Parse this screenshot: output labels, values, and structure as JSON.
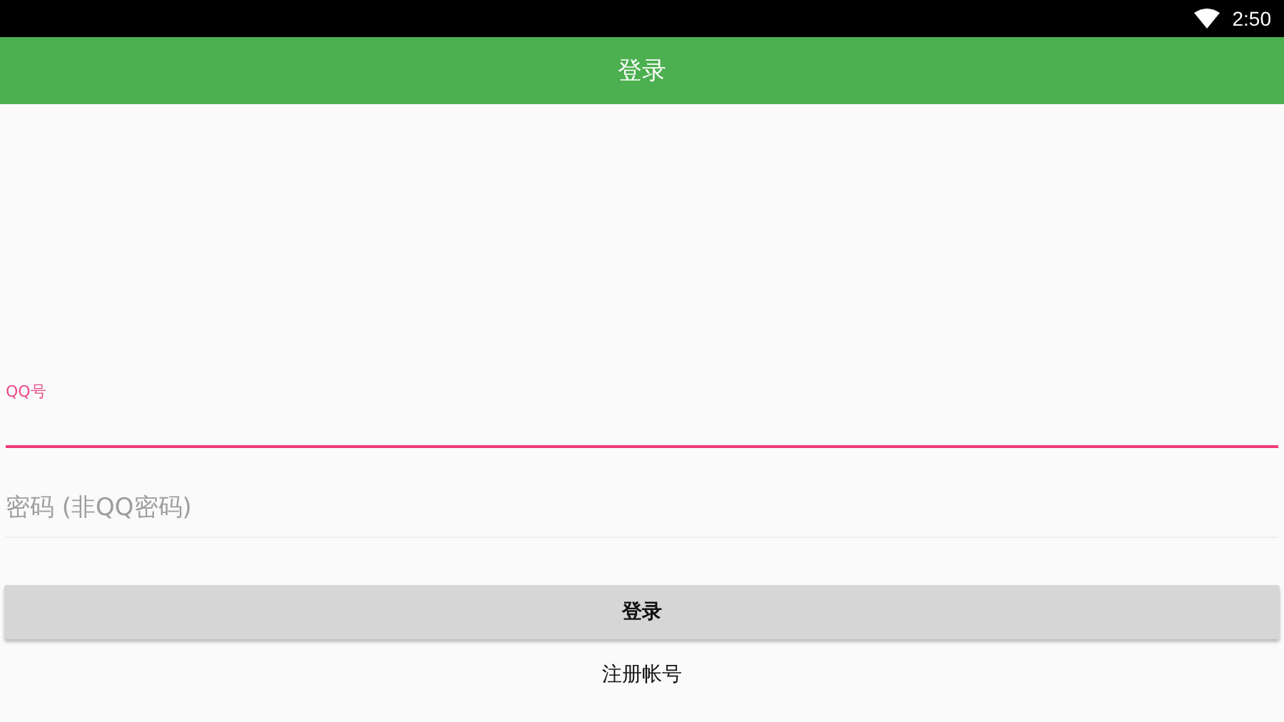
{
  "status_bar": {
    "time": "2:50"
  },
  "app_bar": {
    "title": "登录"
  },
  "fields": [
    {
      "label": "QQ号",
      "focused": true
    },
    {
      "placeholder": "密码 (非QQ密码)",
      "focused": false
    }
  ],
  "login_button": {
    "label": "登录"
  },
  "register_link": {
    "label": "注册帐号"
  }
}
